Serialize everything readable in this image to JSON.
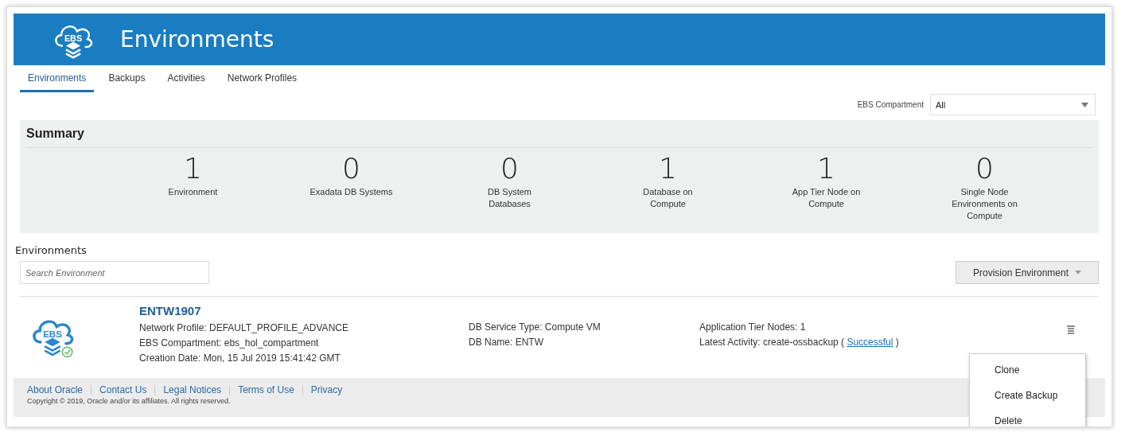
{
  "header": {
    "logo_text": "EBS",
    "title": "Environments"
  },
  "tabs": [
    {
      "label": "Environments",
      "selected": true
    },
    {
      "label": "Backups",
      "selected": false
    },
    {
      "label": "Activities",
      "selected": false
    },
    {
      "label": "Network Profiles",
      "selected": false
    }
  ],
  "compartment_filter": {
    "label": "EBS Compartment",
    "value": "All"
  },
  "summary": {
    "title": "Summary",
    "stats": [
      {
        "count": "1",
        "label": "Environment"
      },
      {
        "count": "0",
        "label": "Exadata DB Systems"
      },
      {
        "count": "0",
        "label": "DB System Databases"
      },
      {
        "count": "1",
        "label": "Database on Compute"
      },
      {
        "count": "1",
        "label": "App Tier Node on Compute"
      },
      {
        "count": "0",
        "label": "Single Node Environments on Compute"
      }
    ]
  },
  "environments": {
    "heading": "Environments",
    "search": {
      "placeholder": "Search Environment"
    },
    "provision_button": "Provision Environment",
    "items": [
      {
        "logo_text": "EBS",
        "name": "ENTW1907",
        "network_profile": "Network Profile: DEFAULT_PROFILE_ADVANCE",
        "compartment": "EBS Compartment: ebs_hol_compartment",
        "creation_date": "Creation Date: Mon, 15 Jul 2019 15:41:42 GMT",
        "db_service_type": "DB Service Type: Compute VM",
        "db_name": "DB Name: ENTW",
        "app_tier_nodes": "Application Tier Nodes: 1",
        "latest_activity": {
          "text": "Latest Activity: create-ossbackup (",
          "link": "Successful",
          "after": ")"
        }
      }
    ]
  },
  "actions_menu": [
    "Clone",
    "Create Backup",
    "Delete"
  ],
  "footer": {
    "links": [
      "About Oracle",
      "Contact Us",
      "Legal Notices",
      "Terms of Use",
      "Privacy"
    ],
    "copyright": "Copyright © 2019, Oracle and/or its affiliates. All rights reserved."
  }
}
